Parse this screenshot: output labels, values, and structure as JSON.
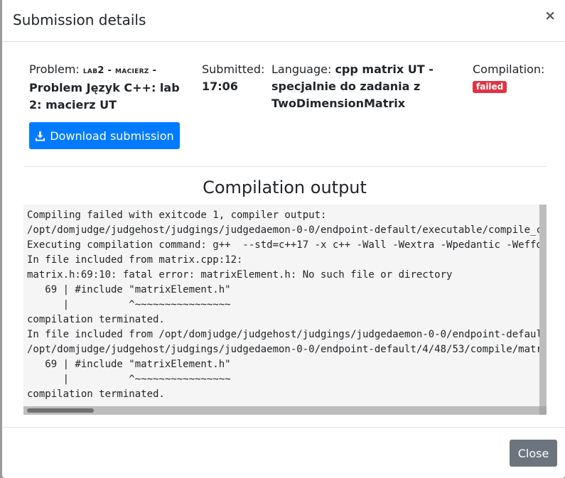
{
  "modal": {
    "title": "Submission details",
    "close_symbol": "×"
  },
  "problem": {
    "label": "Problem: ",
    "code": "lab2 - macierz -",
    "name": "Problem Język C++: lab 2: macierz UT"
  },
  "submitted": {
    "label": "Submitted:",
    "time": "17:06"
  },
  "language": {
    "label": "Language: ",
    "value": "cpp matrix UT - specjalnie do zadania z TwoDimensionMatrix"
  },
  "compilation": {
    "label": "Compilation:",
    "status": "failed",
    "status_color": "#dc3545"
  },
  "download_button": {
    "label": "Download submission",
    "icon": "download-icon",
    "color": "#007bff"
  },
  "output": {
    "title": "Compilation output",
    "lines": [
      "Compiling failed with exitcode 1, compiler output:",
      "/opt/domjudge/judgehost/judgings/judgedaemon-0-0/endpoint-default/executable/compile_c",
      "Executing compilation command: g++  --std=c++17 -x c++ -Wall -Wextra -Wpedantic -Weffo",
      "In file included from matrix.cpp:12:",
      "matrix.h:69:10: fatal error: matrixElement.h: No such file or directory",
      "   69 | #include \"matrixElement.h\"",
      "      |          ^~~~~~~~~~~~~~~~~",
      "compilation terminated.",
      "In file included from /opt/domjudge/judgehost/judgings/judgedaemon-0-0/endpoint-defaul",
      "/opt/domjudge/judgehost/judgings/judgedaemon-0-0/endpoint-default/4/48/53/compile/matr",
      "   69 | #include \"matrixElement.h\"",
      "      |          ^~~~~~~~~~~~~~~~~",
      "compilation terminated."
    ]
  },
  "footer": {
    "close_label": "Close",
    "close_color": "#6c757d"
  }
}
